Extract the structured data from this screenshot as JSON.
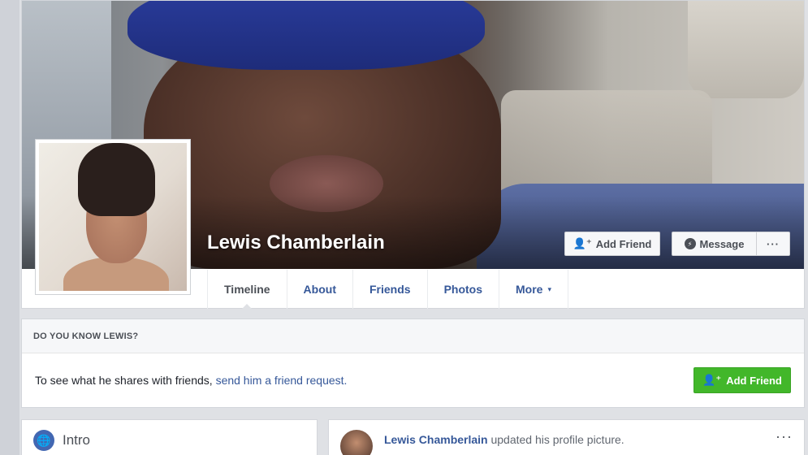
{
  "profile": {
    "name": "Lewis Chamberlain",
    "add_friend_label": "Add Friend",
    "message_label": "Message",
    "more_actions_label": "···"
  },
  "tabs": [
    {
      "label": "Timeline",
      "active": true
    },
    {
      "label": "About"
    },
    {
      "label": "Friends"
    },
    {
      "label": "Photos"
    },
    {
      "label": "More",
      "caret": "▾"
    }
  ],
  "know_card": {
    "header": "DO YOU KNOW LEWIS?",
    "text": "To see what he shares with friends,",
    "link": "send him a friend request.",
    "button_label": "Add Friend"
  },
  "intro": {
    "title": "Intro",
    "icon": "globe-icon"
  },
  "post": {
    "author": "Lewis Chamberlain",
    "action": "updated his profile picture.",
    "more_label": "···"
  },
  "icons": {
    "add_friend": "add-friend-icon",
    "message": "messenger-icon",
    "globe": "globe-icon"
  },
  "colors": {
    "link_blue": "#365899",
    "add_friend_green": "#42b72a",
    "page_bg": "#dfe1e5"
  }
}
